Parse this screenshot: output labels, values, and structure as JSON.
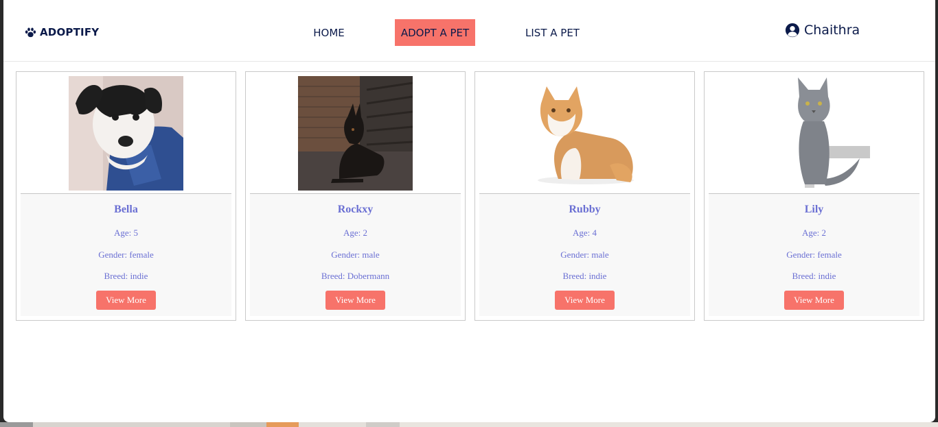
{
  "brand": {
    "name": "ADOPTIFY",
    "icon": "paw-icon"
  },
  "nav": {
    "home": "HOME",
    "adopt": "ADOPT A PET",
    "list": "LIST A PET"
  },
  "user": {
    "name": "Chaithra",
    "icon": "user-circle-icon"
  },
  "colors": {
    "accent": "#f7736a",
    "navy": "#0b1a4a",
    "pet_text": "#6a6fd3"
  },
  "pets": [
    {
      "name": "Bella",
      "age": "Age: 5",
      "gender": "Gender: female",
      "breed": "Breed: indie",
      "button": "View More",
      "image": "puppy-photo"
    },
    {
      "name": "Rockxy",
      "age": "Age: 2",
      "gender": "Gender: male",
      "breed": "Breed: Dobermann",
      "button": "View More",
      "image": "dobermann-photo"
    },
    {
      "name": "Rubby",
      "age": "Age: 4",
      "gender": "Gender: male",
      "breed": "Breed: indie",
      "button": "View More",
      "image": "plush-cat-photo"
    },
    {
      "name": "Lily",
      "age": "Age: 2",
      "gender": "Gender: female",
      "breed": "Breed: indie",
      "button": "View More",
      "image": "grey-kitten-photo"
    }
  ]
}
